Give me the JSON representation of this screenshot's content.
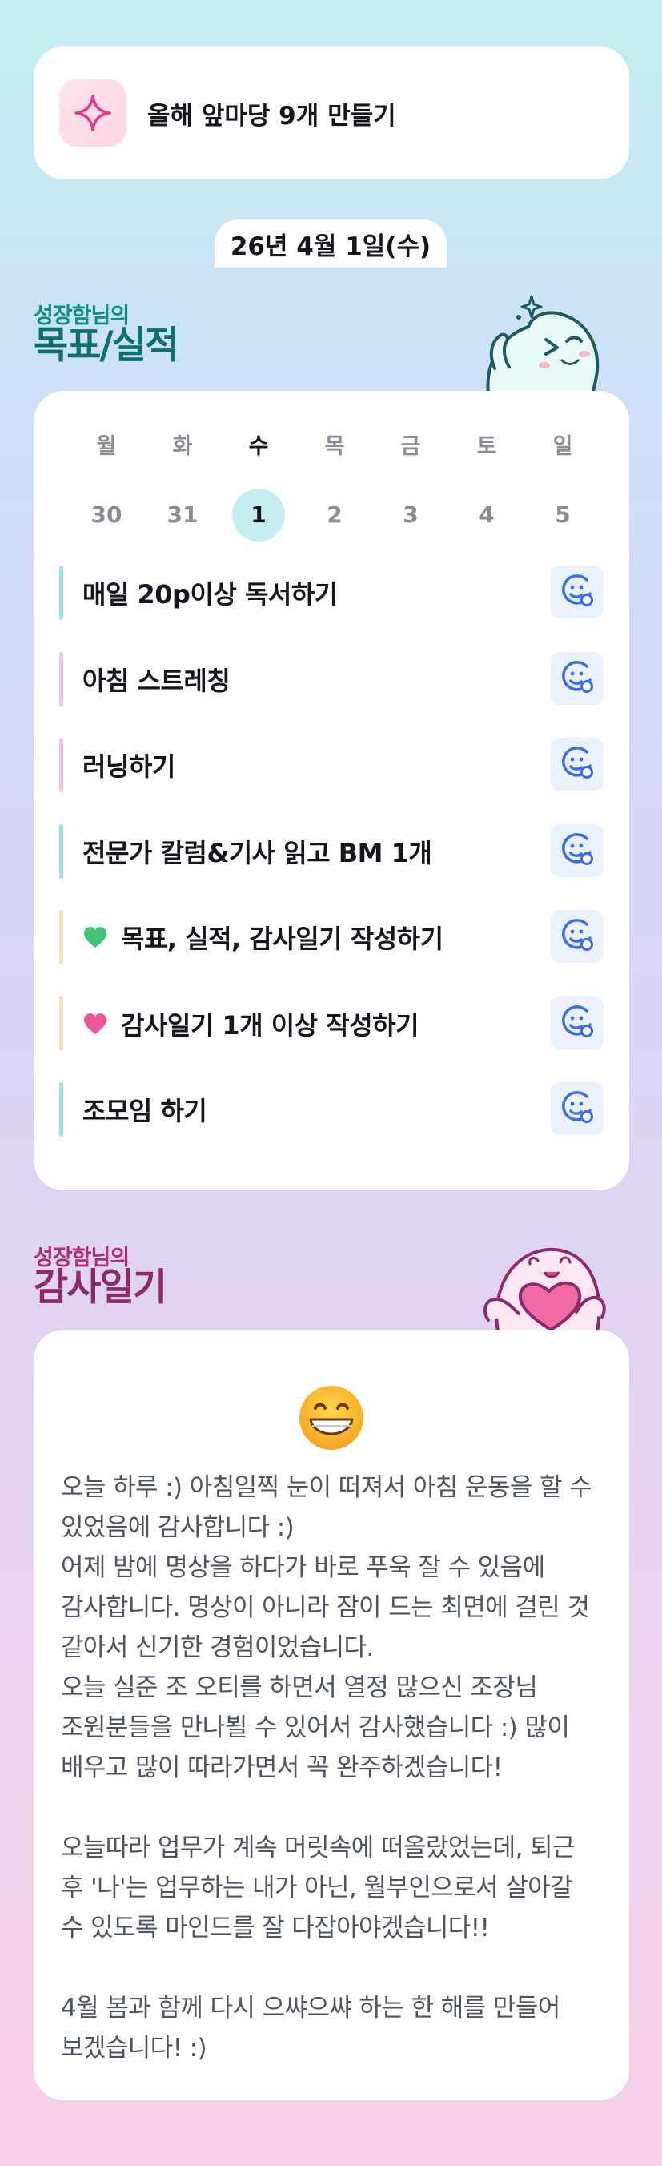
{
  "goal": {
    "title": "올해 앞마당 9개 만들기",
    "icon": "sparkle-icon",
    "accent": "#e53a8a"
  },
  "date": "26년 4월 1일(수)",
  "goals_section": {
    "small": "성장함님의",
    "big": "목표/실적"
  },
  "week": [
    {
      "name": "월",
      "num": "30",
      "active": false
    },
    {
      "name": "화",
      "num": "31",
      "active": false
    },
    {
      "name": "수",
      "num": "1",
      "active": true
    },
    {
      "name": "목",
      "num": "2",
      "active": false
    },
    {
      "name": "금",
      "num": "3",
      "active": false
    },
    {
      "name": "토",
      "num": "4",
      "active": false
    },
    {
      "name": "일",
      "num": "5",
      "active": false
    }
  ],
  "tasks": [
    {
      "label": "매일 20p이상 독서하기",
      "bar_color": "#9fe3dd",
      "emoji": ""
    },
    {
      "label": "아침 스트레칭",
      "bar_color": "#f7c2dc",
      "emoji": ""
    },
    {
      "label": "러닝하기",
      "bar_color": "#f7c2dc",
      "emoji": ""
    },
    {
      "label": "전문가 칼럼&기사 읽고 BM 1개",
      "bar_color": "#9fe3dd",
      "emoji": ""
    },
    {
      "label": "목표, 실적, 감사일기 작성하기",
      "bar_color": "#fbe0b8",
      "emoji": "green-heart-icon"
    },
    {
      "label": "감사일기 1개 이상 작성하기",
      "bar_color": "#fbe0b8",
      "emoji": "pink-heart-icon"
    },
    {
      "label": "조모임 하기",
      "bar_color": "#9fe3dd",
      "emoji": ""
    }
  ],
  "diary_section": {
    "small": "성장함님의",
    "big": "감사일기"
  },
  "diary": {
    "emoji": "grinning-face-icon",
    "text": "오늘 하루 :) 아침일찍 눈이 떠져서 아침 운동을 할 수 있었음에 감사합니다 :)\n어제 밤에 명상을 하다가 바로 푸욱 잘 수 있음에 감사합니다. 명상이 아니라 잠이 드는 최면에 걸린 것 같아서 신기한 경험이었습니다.\n오늘 실준 조 오티를 하면서 열정 많으신 조장님 조원분들을 만나뵐 수 있어서 감사했습니다 :) 많이 배우고 많이 따라가면서 꼭 완주하겠습니다!\n\n오늘따라 업무가 계속 머릿속에 떠올랐었는데, 퇴근 후 '나'는 업무하는 내가 아닌, 월부인으로서 살아갈 수 있도록 마인드를 잘 다잡아야겠습니다!!\n\n4월 봄과 함께 다시 으쌰으쌰 하는 한 해를 만들어 보겠습니다! :)"
  },
  "colors": {
    "check_bg": "#eaf2ff",
    "check_icon": "#3b6cf5",
    "active_day": "#c6eef2"
  }
}
